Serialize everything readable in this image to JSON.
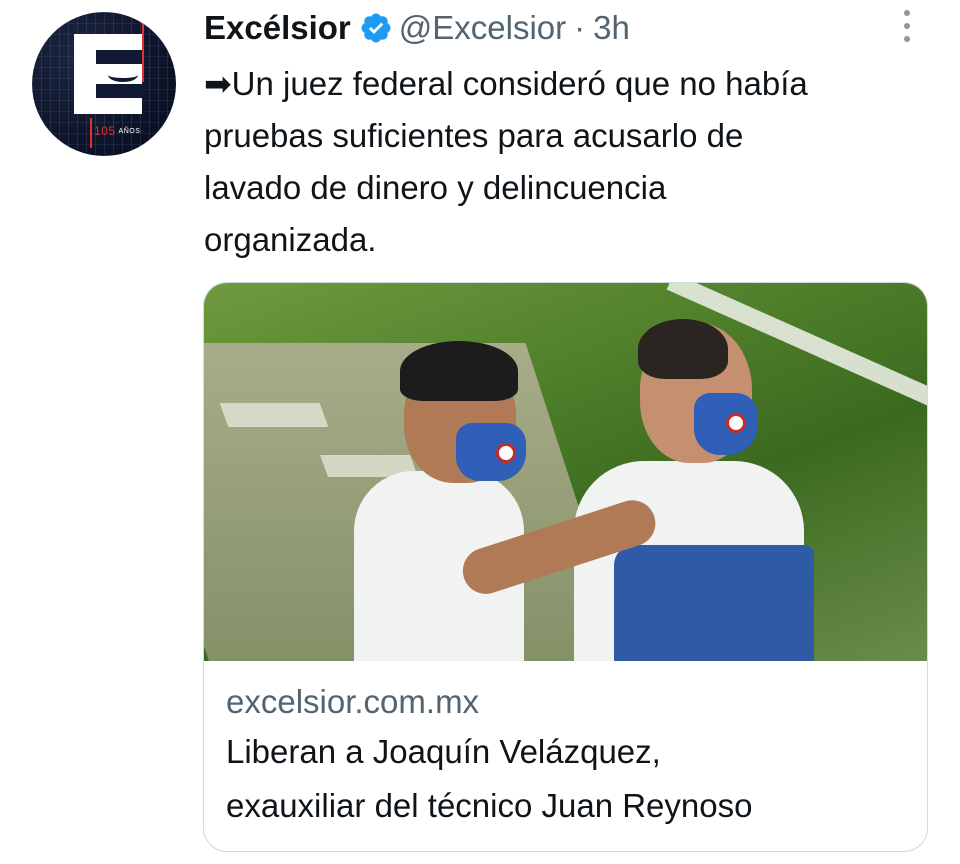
{
  "tweet": {
    "author_name": "Excélsior",
    "handle": "@Excelsior",
    "separator": "·",
    "time": "3h",
    "text": "➡Un juez federal consideró que no había\npruebas suficientes para acusarlo de\nlavado de dinero y delincuencia\norganizada."
  },
  "avatar": {
    "logo_letter": "E",
    "years_number": "105",
    "years_word": "AÑOS"
  },
  "link_card": {
    "domain": "excelsior.com.mx",
    "title": "Liberan a Joaquín Velázquez,\nexauxiliar del técnico Juan Reynoso"
  },
  "icons": {
    "verified": "verified-badge-icon",
    "more": "more-options-icon"
  },
  "colors": {
    "verified_blue": "#1d9bf0",
    "secondary_text": "#536471",
    "primary_text": "#0f1419",
    "card_border": "#cfd9de"
  }
}
